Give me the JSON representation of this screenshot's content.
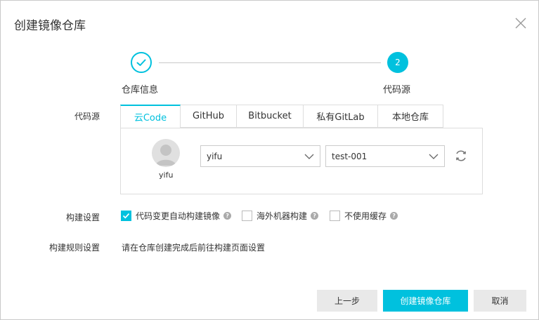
{
  "dialog": {
    "title": "创建镜像仓库"
  },
  "stepper": {
    "steps": [
      {
        "label": "仓库信息",
        "status": "completed"
      },
      {
        "label": "代码源",
        "number": "2",
        "status": "active"
      }
    ]
  },
  "form": {
    "source_label": "代码源",
    "tabs": [
      {
        "label": "云Code",
        "active": true
      },
      {
        "label": "GitHub"
      },
      {
        "label": "Bitbucket"
      },
      {
        "label": "私有GitLab"
      },
      {
        "label": "本地仓库"
      }
    ],
    "account": {
      "name": "yifu"
    },
    "namespace_select": {
      "value": "yifu"
    },
    "repo_select": {
      "value": "test-001"
    },
    "build_label": "构建设置",
    "build_options": [
      {
        "label": "代码变更自动构建镜像",
        "checked": true
      },
      {
        "label": "海外机器构建",
        "checked": false
      },
      {
        "label": "不使用缓存",
        "checked": false
      }
    ],
    "help_mark": "?",
    "rule_label": "构建规则设置",
    "rule_text": "请在仓库创建完成后前往构建页面设置"
  },
  "footer": {
    "prev_label": "上一步",
    "create_label": "创建镜像仓库",
    "cancel_label": "取消"
  },
  "colors": {
    "accent": "#00c1de",
    "gray_button": "#e9e9e9"
  }
}
